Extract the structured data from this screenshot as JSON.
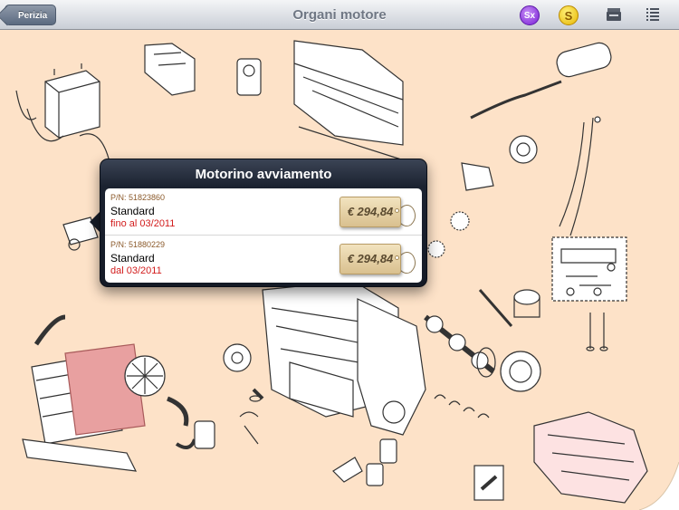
{
  "navbar": {
    "back_label": "Perizia",
    "title": "Organi motore",
    "sx_label": "Sx",
    "coin_label": "S"
  },
  "popover": {
    "title": "Motorino avviamento",
    "rows": [
      {
        "pn": "P/N: 51823860",
        "description": "Standard",
        "validity": "fino al 03/2011",
        "price": "€ 294,84"
      },
      {
        "pn": "P/N: 51880229",
        "description": "Standard",
        "validity": "dal 03/2011",
        "price": "€ 294,84"
      }
    ]
  },
  "colors": {
    "background": "#fde2c8",
    "sx_badge": "#7a1fd6",
    "coin_badge": "#e6b400",
    "validity_text": "#d21c1c",
    "part_number": "#8b5a2b"
  },
  "icons": [
    "back-chevron",
    "sx-icon",
    "coin-icon",
    "tray-icon",
    "menu-icon"
  ]
}
